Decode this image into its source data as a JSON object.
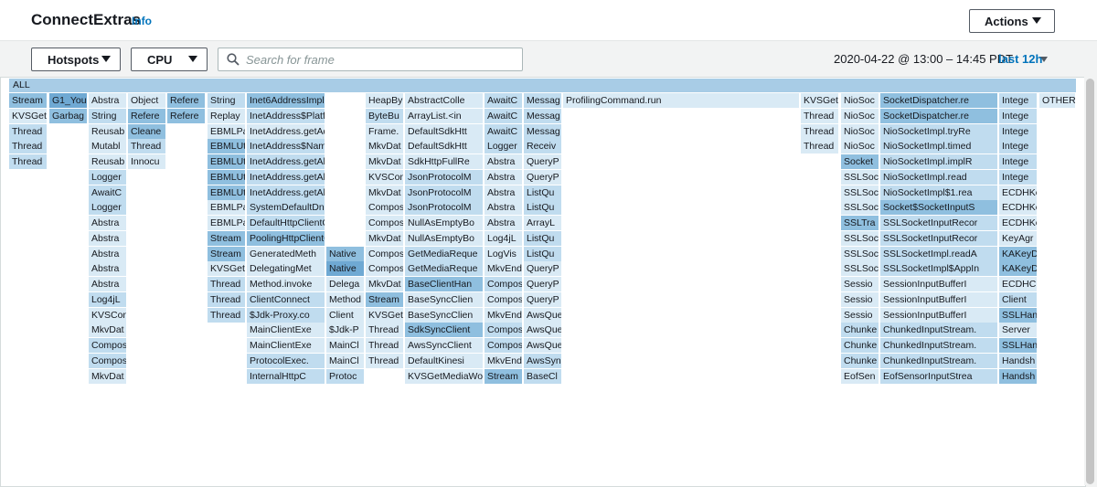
{
  "header": {
    "title": "ConnectExtras",
    "info_link": "Info",
    "actions_label": "Actions"
  },
  "toolbar": {
    "view_select": "Hotspots",
    "metric_select": "CPU",
    "search_placeholder": "Search for frame",
    "time_range": "2020-04-22 @ 13:00 – 14:45 PDT",
    "range_select": "last 12h"
  },
  "flamegraph": {
    "root_label": "ALL",
    "columns": [
      {
        "frames": [
          [
            "Stream",
            2
          ],
          [
            "KVSGet",
            0
          ],
          [
            "Thread",
            1
          ],
          [
            "Thread",
            1
          ],
          [
            "Thread",
            1
          ]
        ]
      },
      {
        "frames": [
          [
            "G1_You",
            3
          ],
          [
            "Garbag",
            2
          ]
        ]
      },
      {
        "frames": [
          [
            "Abstra",
            0
          ],
          [
            "String",
            1
          ],
          [
            "Reusab",
            0
          ],
          [
            "Mutabl",
            0
          ],
          [
            "Reusab",
            0
          ],
          [
            "Logger",
            1
          ],
          [
            "AwaitC",
            1
          ],
          [
            "Logger",
            1
          ],
          [
            "Abstra",
            0
          ],
          [
            "Abstra",
            0
          ],
          [
            "Abstra",
            0
          ],
          [
            "Abstra",
            0
          ],
          [
            "Abstra",
            0
          ],
          [
            "Log4jL",
            1
          ],
          [
            "KVSCon",
            0
          ],
          [
            "MkvDat",
            0
          ],
          [
            "Compos",
            1
          ],
          [
            "Compos",
            1
          ],
          [
            "MkvDat",
            0
          ]
        ]
      },
      {
        "frames": [
          [
            "Object",
            0
          ],
          [
            "Refere",
            2
          ],
          [
            "Cleane",
            2
          ],
          [
            "Thread",
            1
          ],
          [
            "Innocu",
            0
          ]
        ]
      },
      {
        "frames": [
          [
            "Refere",
            2
          ],
          [
            "Refere",
            2
          ]
        ]
      },
      {
        "frames": [
          [
            "String",
            1
          ],
          [
            "Replay",
            0
          ],
          [
            "EBMLPa",
            0
          ],
          [
            "EBMLUt",
            2
          ],
          [
            "EBMLUt",
            2
          ],
          [
            "EBMLUt",
            2
          ],
          [
            "EBMLUt",
            2
          ],
          [
            "EBMLPa",
            0
          ],
          [
            "EBMLPa",
            0
          ],
          [
            "Stream",
            2
          ],
          [
            "Stream",
            2
          ],
          [
            "KVSGet",
            0
          ],
          [
            "Thread",
            1
          ],
          [
            "Thread",
            1
          ],
          [
            "Thread",
            1
          ]
        ]
      },
      {
        "frames": [
          [
            "Inet6AddressImpl.lo",
            2
          ],
          [
            "InetAddress$Platfor",
            1
          ],
          [
            "InetAddress.getAddr",
            0
          ],
          [
            "InetAddress$NameSer",
            1
          ],
          [
            "InetAddress.getAllB",
            1
          ],
          [
            "InetAddress.getAllB",
            1
          ],
          [
            "InetAddress.getAllB",
            1
          ],
          [
            "SystemDefaultDnsRes",
            1
          ],
          [
            "DefaultHttpClientCo",
            1
          ],
          [
            "PoolingHttpClientCo",
            2
          ],
          [
            "GeneratedMeth",
            0
          ],
          [
            "DelegatingMet",
            0
          ],
          [
            "Method.invoke",
            0
          ],
          [
            "ClientConnect",
            1
          ],
          [
            "$Jdk-Proxy.co",
            1
          ],
          [
            "MainClientExe",
            0
          ],
          [
            "MainClientExe",
            0
          ],
          [
            "ProtocolExec.",
            1
          ],
          [
            "InternalHttpC",
            1
          ]
        ]
      },
      {
        "frames": [
          [
            "Native",
            2
          ],
          [
            "Native",
            3
          ],
          [
            "Delega",
            0
          ],
          [
            "Method",
            0
          ],
          [
            "Client",
            0
          ],
          [
            "$Jdk-P",
            0
          ],
          [
            "MainCl",
            0
          ],
          [
            "MainCl",
            0
          ],
          [
            "Protoc",
            1
          ]
        ],
        "start": 10
      },
      {
        "frames": [
          [
            "HeapBy",
            0
          ],
          [
            "ByteBu",
            1
          ],
          [
            "Frame.",
            0
          ],
          [
            "MkvDat",
            0
          ],
          [
            "MkvDat",
            0
          ],
          [
            "KVSCon",
            0
          ],
          [
            "MkvDat",
            0
          ],
          [
            "Compos",
            0
          ],
          [
            "Compos",
            0
          ],
          [
            "MkvDat",
            0
          ],
          [
            "Compos",
            0
          ],
          [
            "Compos",
            0
          ],
          [
            "MkvDat",
            0
          ],
          [
            "Stream",
            2
          ],
          [
            "KVSGet",
            0
          ],
          [
            "Thread",
            0
          ],
          [
            "Thread",
            0
          ],
          [
            "Thread",
            0
          ]
        ]
      },
      {
        "frames": [
          [
            "AbstractColle",
            0
          ],
          [
            "ArrayList.<in",
            0
          ],
          [
            "DefaultSdkHtt",
            0
          ],
          [
            "DefaultSdkHtt",
            0
          ],
          [
            "SdkHttpFullRe",
            0
          ],
          [
            "JsonProtocolM",
            1
          ],
          [
            "JsonProtocolM",
            1
          ],
          [
            "JsonProtocolM",
            1
          ],
          [
            "NullAsEmptyBo",
            0
          ],
          [
            "NullAsEmptyBo",
            0
          ],
          [
            "GetMediaReque",
            1
          ],
          [
            "GetMediaReque",
            1
          ],
          [
            "BaseClientHan",
            2
          ],
          [
            "BaseSyncClien",
            0
          ],
          [
            "BaseSyncClien",
            0
          ],
          [
            "SdkSyncClient",
            2
          ],
          [
            "AwsSyncClient",
            0
          ],
          [
            "DefaultKinesi",
            0
          ],
          [
            "KVSGetMediaWo",
            0
          ]
        ]
      },
      {
        "frames": [
          [
            "AwaitC",
            1
          ],
          [
            "AwaitC",
            1
          ],
          [
            "AwaitC",
            1
          ],
          [
            "Logger",
            1
          ],
          [
            "Abstra",
            0
          ],
          [
            "Abstra",
            0
          ],
          [
            "Abstra",
            0
          ],
          [
            "Abstra",
            0
          ],
          [
            "Abstra",
            0
          ],
          [
            "Log4jL",
            0
          ],
          [
            "LogVis",
            0
          ],
          [
            "MkvEnd",
            0
          ],
          [
            "Compos",
            1
          ],
          [
            "Compos",
            0
          ],
          [
            "MkvEnd",
            0
          ],
          [
            "Compos",
            1
          ],
          [
            "Compos",
            1
          ],
          [
            "MkvEnd",
            0
          ],
          [
            "Stream",
            2
          ]
        ]
      },
      {
        "frames": [
          [
            "Messag",
            1
          ],
          [
            "Messag",
            1
          ],
          [
            "Messag",
            1
          ],
          [
            "Receiv",
            1
          ],
          [
            "QueryP",
            0
          ],
          [
            "QueryP",
            0
          ],
          [
            "ListQu",
            1
          ],
          [
            "ListQu",
            1
          ],
          [
            "ArrayL",
            0
          ],
          [
            "ListQu",
            1
          ],
          [
            "ListQu",
            1
          ],
          [
            "QueryP",
            0
          ],
          [
            "QueryP",
            0
          ],
          [
            "QueryP",
            0
          ],
          [
            "AwsQue",
            0
          ],
          [
            "AwsQue",
            0
          ],
          [
            "AwsQue",
            0
          ],
          [
            "AwsSyn",
            1
          ],
          [
            "BaseCl",
            1
          ]
        ]
      },
      {
        "frames": [
          [
            "ProfilingCommand.run",
            0
          ]
        ]
      },
      {
        "frames": [
          [
            "KVSGet",
            0
          ],
          [
            "Thread",
            0
          ],
          [
            "Thread",
            0
          ],
          [
            "Thread",
            0
          ]
        ]
      },
      {
        "frames": [
          [
            "NioSoc",
            0
          ],
          [
            "NioSoc",
            0
          ],
          [
            "NioSoc",
            0
          ],
          [
            "NioSoc",
            0
          ],
          [
            "Socket",
            2
          ],
          [
            "SSLSoc",
            0
          ],
          [
            "SSLSoc",
            0
          ],
          [
            "SSLSoc",
            0
          ],
          [
            "SSLTra",
            2
          ],
          [
            "SSLSoc",
            0
          ],
          [
            "SSLSoc",
            0
          ],
          [
            "SSLSoc",
            0
          ],
          [
            "Sessio",
            0
          ],
          [
            "Sessio",
            0
          ],
          [
            "Sessio",
            0
          ],
          [
            "Chunke",
            1
          ],
          [
            "Chunke",
            1
          ],
          [
            "Chunke",
            1
          ],
          [
            "EofSen",
            0
          ]
        ]
      },
      {
        "frames": [
          [
            "SocketDispatcher.re",
            2
          ],
          [
            "SocketDispatcher.re",
            2
          ],
          [
            "NioSocketImpl.tryRe",
            1
          ],
          [
            "NioSocketImpl.timed",
            1
          ],
          [
            "NioSocketImpl.implR",
            1
          ],
          [
            "NioSocketImpl.read",
            1
          ],
          [
            "NioSocketImpl$1.rea",
            1
          ],
          [
            "Socket$SocketInputS",
            2
          ],
          [
            "SSLSocketInputRecor",
            1
          ],
          [
            "SSLSocketInputRecor",
            1
          ],
          [
            "SSLSocketImpl.readA",
            1
          ],
          [
            "SSLSocketImpl$AppIn",
            1
          ],
          [
            "SessionInputBufferI",
            0
          ],
          [
            "SessionInputBufferI",
            0
          ],
          [
            "SessionInputBufferI",
            0
          ],
          [
            "ChunkedInputStream.",
            1
          ],
          [
            "ChunkedInputStream.",
            1
          ],
          [
            "ChunkedInputStream.",
            1
          ],
          [
            "EofSensorInputStrea",
            1
          ]
        ]
      },
      {
        "frames": [
          [
            "Intege",
            1
          ],
          [
            "Intege",
            1
          ],
          [
            "Intege",
            1
          ],
          [
            "Intege",
            1
          ],
          [
            "Intege",
            1
          ],
          [
            "Intege",
            1
          ],
          [
            "ECDHKe",
            0
          ],
          [
            "ECDHKe",
            0
          ],
          [
            "ECDHKe",
            0
          ],
          [
            "KeyAgr",
            0
          ],
          [
            "KAKeyD",
            2
          ],
          [
            "KAKeyD",
            2
          ],
          [
            "ECDHCl",
            0
          ],
          [
            "Client",
            1
          ],
          [
            "SSLHan",
            2
          ],
          [
            "Server",
            0
          ],
          [
            "SSLHan",
            2
          ],
          [
            "Handsh",
            1
          ],
          [
            "Handsh",
            2
          ]
        ]
      },
      {
        "frames": [
          [
            "OTHER",
            0
          ]
        ]
      }
    ]
  }
}
